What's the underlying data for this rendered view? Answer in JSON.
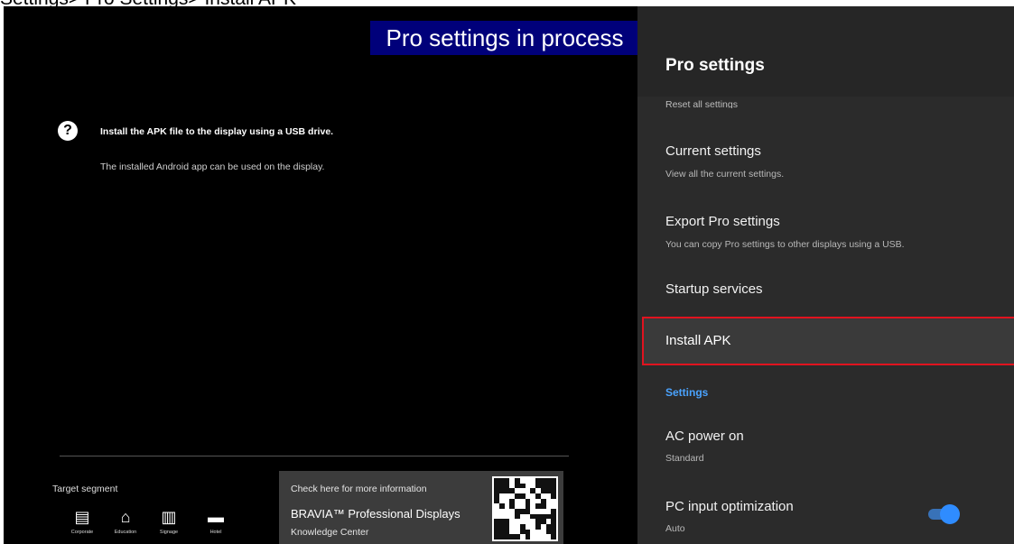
{
  "breadcrumb": "Settings> Pro Settings> Install APK",
  "banner": "Pro settings in process",
  "help": {
    "icon": "question-circle-icon",
    "title": "Install the APK file to the display using a USB drive.",
    "subtitle": "The installed Android app can be used on the display."
  },
  "segment": {
    "label": "Target segment",
    "items": [
      {
        "icon": "building-icon",
        "glyph": "🏢",
        "label": "Corporate"
      },
      {
        "icon": "graduation-cap-icon",
        "glyph": "🎓",
        "label": "Education"
      },
      {
        "icon": "store-icon",
        "glyph": "🏪",
        "label": "Signage"
      },
      {
        "icon": "bed-icon",
        "glyph": "🛏",
        "label": "Hotel"
      }
    ]
  },
  "info": {
    "head": "Check here for more information",
    "title": "BRAVIA™ Professional Displays",
    "subtitle": "Knowledge Center"
  },
  "panel": {
    "title": "Pro settings",
    "peek_item": "Reset all settings",
    "items": [
      {
        "title": "Current settings",
        "subtitle": "View all the current settings."
      },
      {
        "title": "Export Pro settings",
        "subtitle": "You can copy Pro settings to other displays using a USB."
      },
      {
        "title": "Startup services",
        "subtitle": ""
      },
      {
        "title": "Install APK",
        "subtitle": ""
      }
    ],
    "section": "Settings",
    "settings": [
      {
        "title": "AC power on",
        "subtitle": "Standard"
      },
      {
        "title": "PC input optimization",
        "subtitle": "Auto",
        "toggle": "on"
      }
    ],
    "accent": "#4aa3ff",
    "focus_border": "#e1131f"
  }
}
